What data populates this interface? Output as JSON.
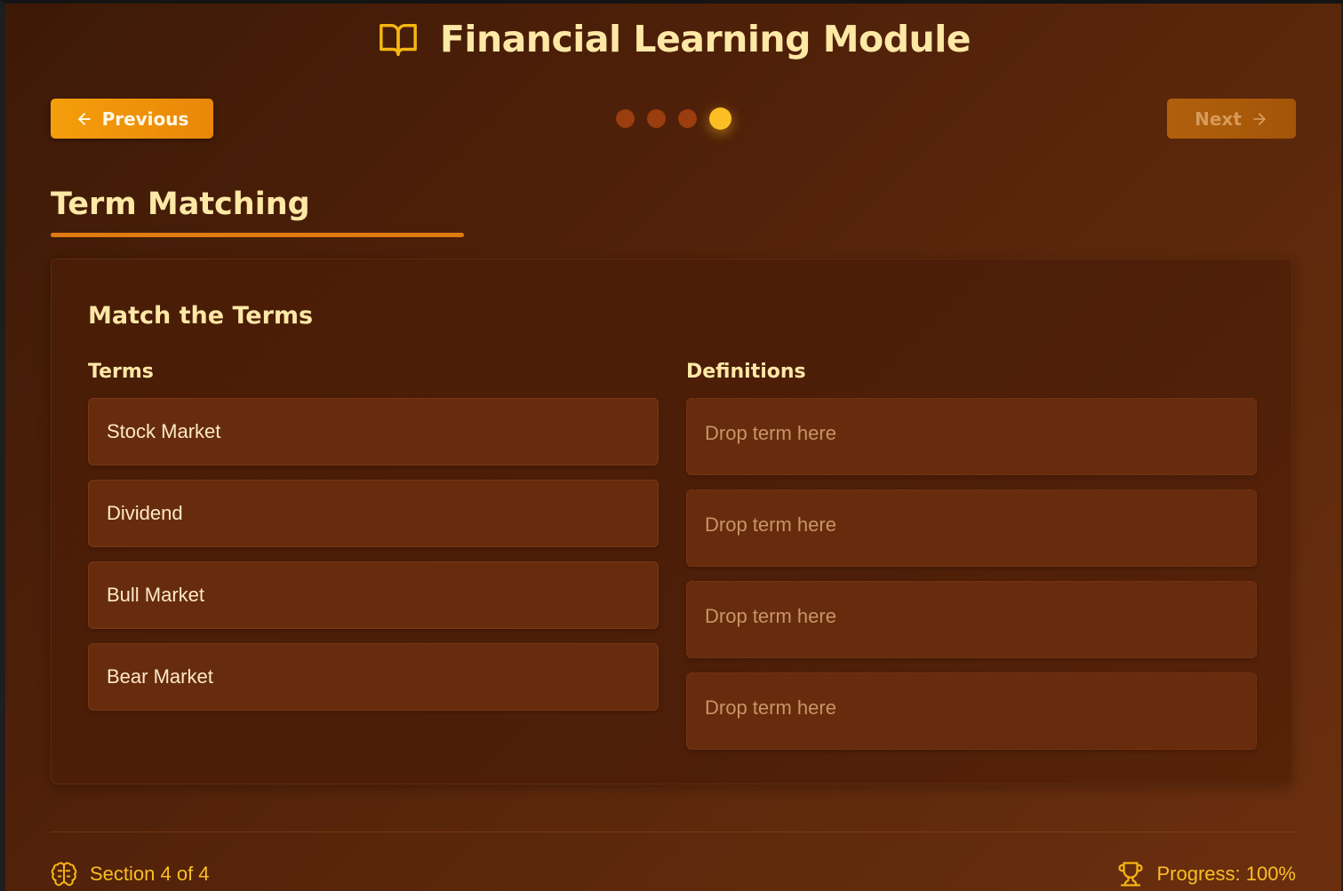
{
  "header": {
    "title": "Financial Learning Module",
    "icon": "book-open-icon"
  },
  "navigation": {
    "previous_label": "Previous",
    "next_label": "Next",
    "total_steps": 4,
    "current_step": 4
  },
  "section": {
    "title": "Term Matching"
  },
  "exercise": {
    "heading": "Match the Terms",
    "terms_label": "Terms",
    "definitions_label": "Definitions",
    "terms": [
      "Stock Market",
      "Dividend",
      "Bull Market",
      "Bear Market"
    ],
    "drop_placeholders": [
      "Drop term here",
      "Drop term here",
      "Drop term here",
      "Drop term here"
    ]
  },
  "footer": {
    "section_text": "Section 4 of 4",
    "progress_text": "Progress: 100%",
    "progress_value": 1.0,
    "section_icon": "brain-icon",
    "progress_icon": "trophy-icon"
  },
  "colors": {
    "accent": "#f59e0b",
    "heading": "#fde8a6",
    "active_dot": "#fbbf24",
    "inactive_dot": "#9a3d0f",
    "underline": "#e07b12"
  }
}
